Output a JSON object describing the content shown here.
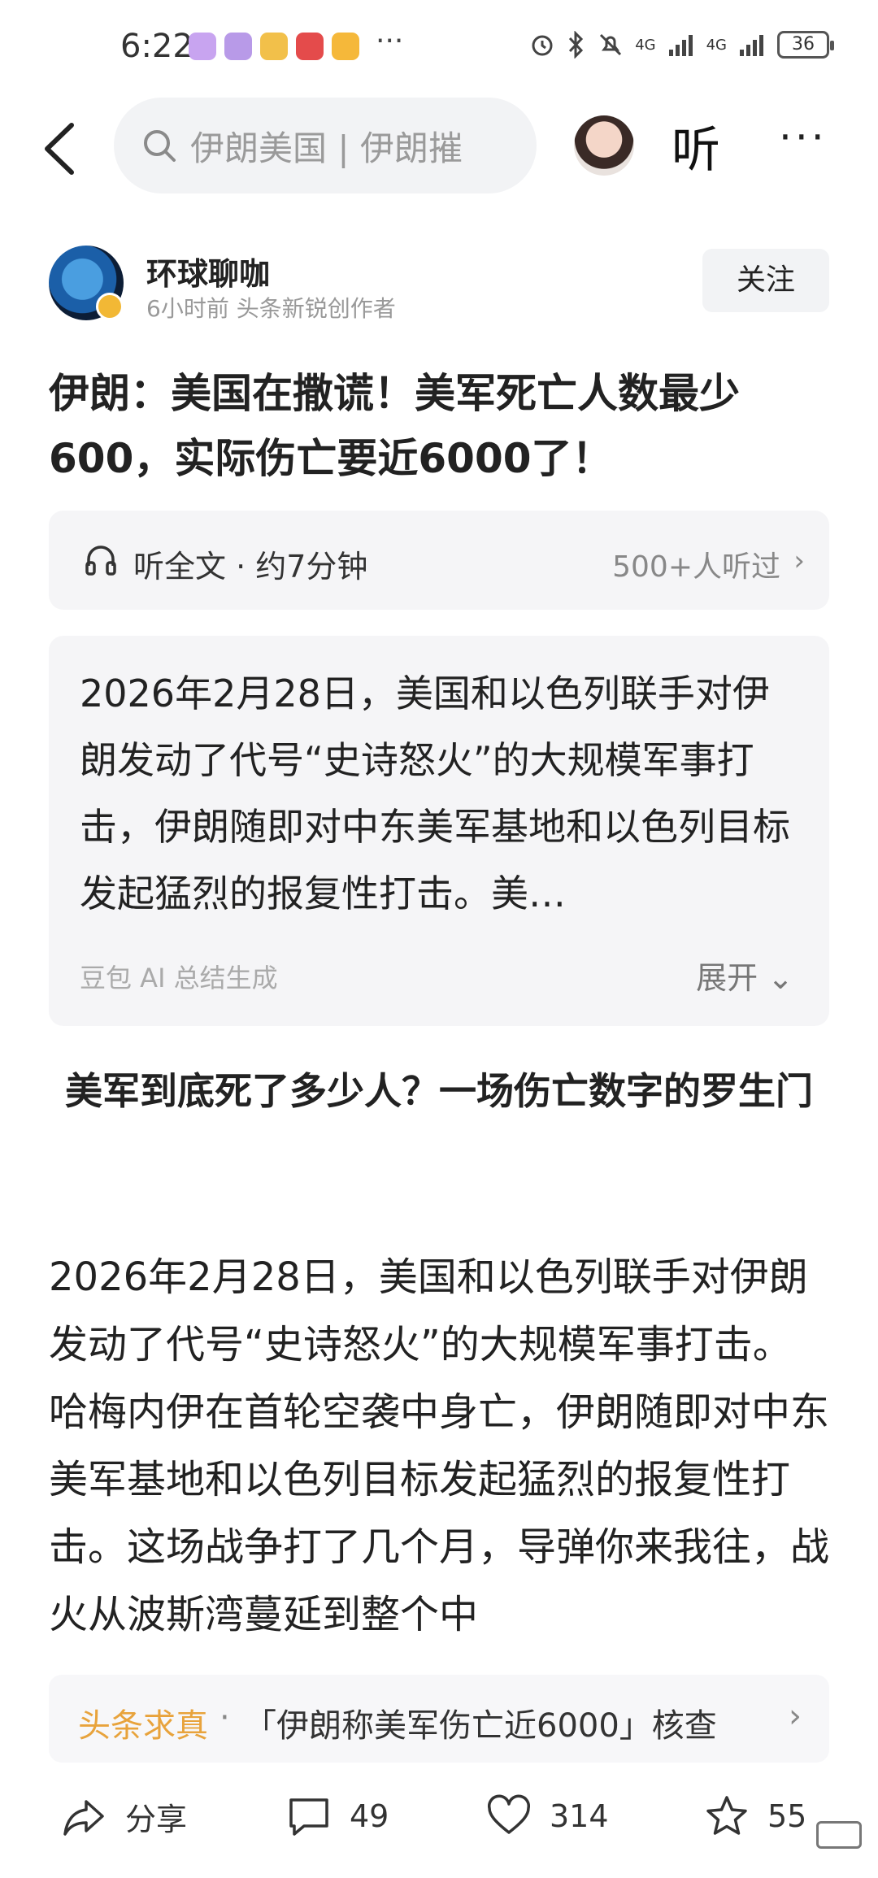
{
  "status": {
    "time": "6:22",
    "overflow": "···",
    "network1": "4G",
    "network2": "4G",
    "battery": "36"
  },
  "header": {
    "search_query": "伊朗美国 | 伊朗摧",
    "listen_label": "听",
    "more_label": "···"
  },
  "author": {
    "name": "环球聊咖",
    "meta": "6小时前   头条新锐创作者",
    "follow_label": "关注"
  },
  "article": {
    "title": "伊朗：美国在撒谎！美军死亡人数最少600，实际伤亡要近6000了！",
    "listen_bar": {
      "label": "听全文 · 约7分钟",
      "count": "500+人听过",
      "chevron": "›"
    },
    "summary": {
      "text": "2026年2月28日，美国和以色列联手对伊朗发动了代号“史诗怒火”的大规模军事打击，伊朗随即对中东美军基地和以色列目标发起猛烈的报复性打击。美…",
      "source": "豆包 AI 总结生成",
      "expand_label": "展开 ⌄"
    },
    "subheading": "美军到底死了多少人？一场伤亡数字的罗生门",
    "body": "2026年2月28日，美国和以色列联手对伊朗发动了代号“史诗怒火”的大规模军事打击。哈梅内伊在首轮空袭中身亡，伊朗随即对中东美军基地和以色列目标发起猛烈的报复性打击。这场战争打了几个月，导弹你来我往，战火从波斯湾蔓延到整个中"
  },
  "factcheck": {
    "tag": "头条求真",
    "separator": "·",
    "text": "「伊朗称美军伤亡近6000」核查",
    "chevron": "›"
  },
  "bottom_bar": {
    "share_label": "分享",
    "comment_count": "49",
    "like_count": "314",
    "favorite_count": "55"
  },
  "colors": {
    "accent_orange": "#e8a33c",
    "panel_bg": "#f5f5f7"
  }
}
